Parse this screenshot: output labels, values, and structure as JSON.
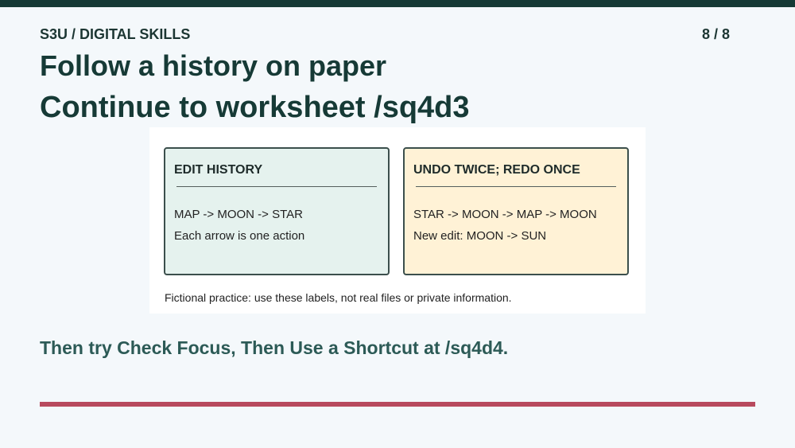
{
  "header": {
    "course": "S3U / DIGITAL SKILLS",
    "page_counter": "8 / 8"
  },
  "titles": {
    "line1": "Follow a history on paper",
    "line2": "Continue to worksheet /sq4d3"
  },
  "cards": [
    {
      "title": "EDIT HISTORY",
      "lines": [
        "MAP -> MOON -> STAR",
        "Each arrow is one action"
      ],
      "background": "#e5f2ee"
    },
    {
      "title": "UNDO TWICE; REDO ONCE",
      "lines": [
        "STAR -> MOON -> MAP -> MOON",
        "New edit: MOON -> SUN"
      ],
      "background": "#fff2d6"
    }
  ],
  "note": "Fictional practice: use these labels, not real files or private information.",
  "footer": {
    "next_steps": "Then try Check Focus, Then Use a Shortcut at /sq4d4."
  },
  "colors": {
    "top_bar": "#163a36",
    "accent_rule": "#b84a5e",
    "page_background": "#f4f8fb"
  }
}
